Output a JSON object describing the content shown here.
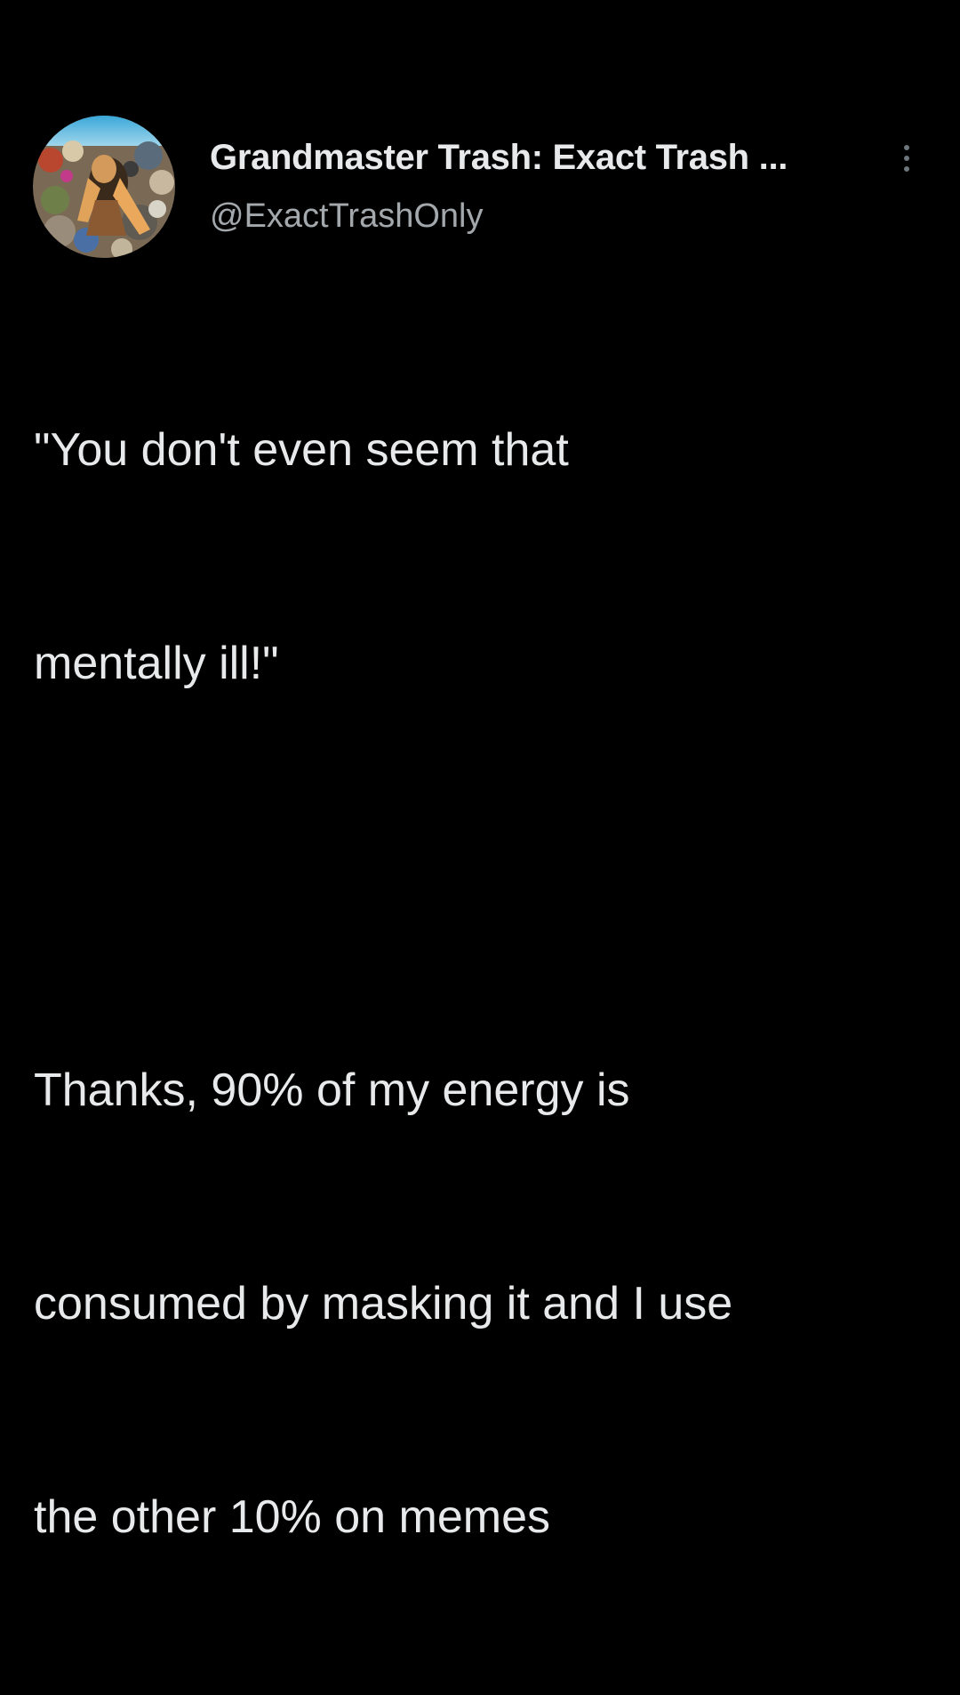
{
  "tweet": {
    "author": {
      "display_name": "Grandmaster Trash: Exact Trash ...",
      "handle": "@ExactTrashOnly",
      "avatar_icon": "profile-photo"
    },
    "more_icon": "vertical-ellipsis-icon",
    "text": {
      "quote_line_1": "\"You don't even seem that",
      "quote_line_2": "mentally ill!\"",
      "reply_line_1": "Thanks, 90% of my energy is",
      "reply_line_2": "consumed by masking it and I use",
      "reply_line_3": "the other 10% on memes"
    }
  },
  "colors": {
    "background": "#000000",
    "primary_text": "#e7e9ea",
    "secondary_text": "#a3a8ad"
  }
}
